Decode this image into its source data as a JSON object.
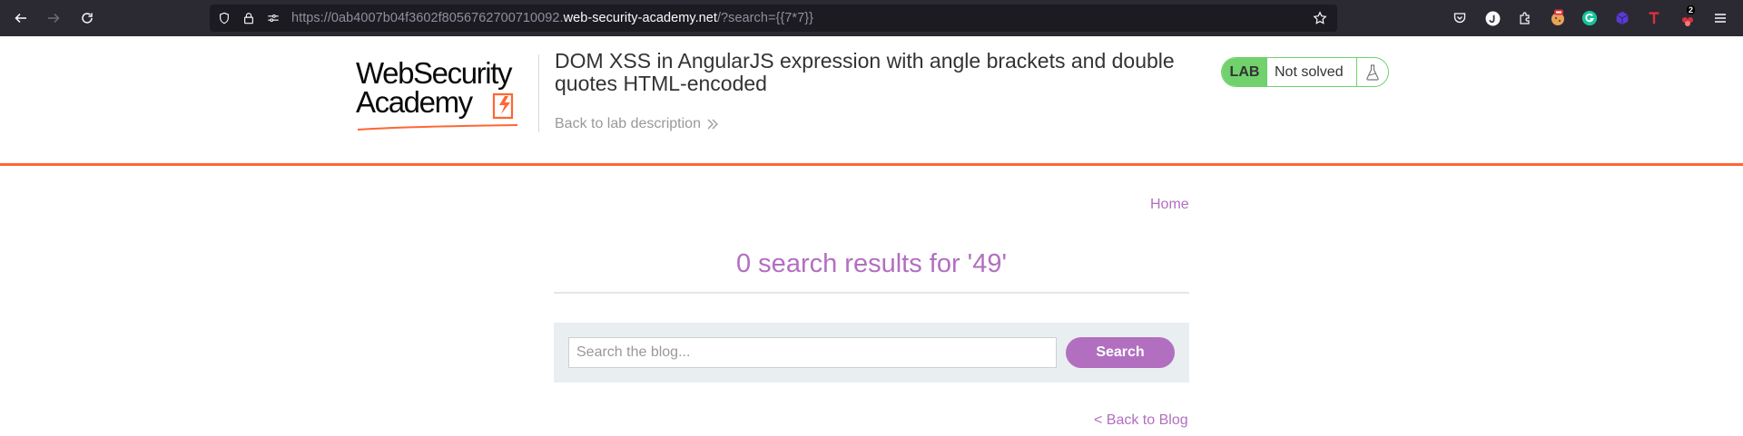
{
  "browser": {
    "url_prefix": "https://0ab4007b04f3602f8056762700710092.",
    "url_host": "web-security-academy.net",
    "url_path": "/?search={{7*7}}",
    "extension_badge": "2"
  },
  "lab_header": {
    "logo_line1": "WebSecurity",
    "logo_line2": "Academy",
    "title": "DOM XSS in AngularJS expression with angle brackets and double quotes HTML-encoded",
    "back_link": "Back to lab description",
    "status_label": "LAB",
    "status_value": "Not solved"
  },
  "blog": {
    "home_link": "Home",
    "results_heading": "0 search results for '49'",
    "search_placeholder": "Search the blog...",
    "search_button": "Search",
    "back_link": "< Back to Blog"
  },
  "colors": {
    "accent": "#b26fc0",
    "header_rule": "#ff6633",
    "lab_green": "#70d16d"
  }
}
